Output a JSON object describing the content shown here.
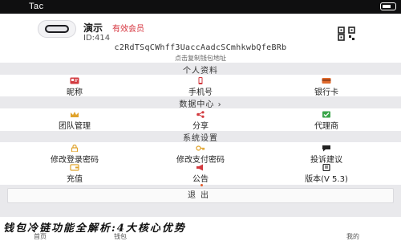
{
  "status_bar": {
    "carrier": "Tac"
  },
  "profile": {
    "name": "演示",
    "badge": "有效会员",
    "id_label": "ID:414",
    "address": "c2RdTSqCWhff3UaccAadcSCmhkwbQfeBRb",
    "address_tip": "点击复制钱包地址"
  },
  "sections": {
    "personal": {
      "title": "个人资料",
      "items": [
        {
          "label": "昵称",
          "icon": "id-card-icon",
          "color": "#d23a3f"
        },
        {
          "label": "手机号",
          "icon": "phone-icon",
          "color": "#d23a3f"
        },
        {
          "label": "银行卡",
          "icon": "bank-card-icon",
          "color": "#e06a2c"
        }
      ]
    },
    "data_center": {
      "title": "数据中心",
      "items": [
        {
          "label": "团队管理",
          "icon": "crown-icon",
          "color": "#e0a32c"
        },
        {
          "label": "分享",
          "icon": "share-icon",
          "color": "#d23a3f"
        },
        {
          "label": "代理商",
          "icon": "agent-icon",
          "color": "#3aa64a"
        }
      ]
    },
    "system": {
      "title": "系统设置",
      "items": [
        {
          "label": "修改登录密码",
          "icon": "lock-icon",
          "color": "#e0a32c"
        },
        {
          "label": "修改支付密码",
          "icon": "key-icon",
          "color": "#e0a32c"
        },
        {
          "label": "投诉建议",
          "icon": "chat-icon",
          "color": "#222222"
        },
        {
          "label": "充值",
          "icon": "wallet-icon",
          "color": "#e0a32c"
        },
        {
          "label": "公告",
          "icon": "megaphone-icon",
          "color": "#d23a3f"
        },
        {
          "label": "版本(V 5.3)",
          "icon": "version-icon",
          "color": "#222222"
        }
      ]
    }
  },
  "logout": {
    "label": "退出"
  },
  "banner": {
    "text": "钱包冷链功能全解析:4大核心优势"
  },
  "tabbar": {
    "items": [
      {
        "label": "首页"
      },
      {
        "label": "钱包"
      },
      {
        "label": "我的"
      }
    ]
  }
}
